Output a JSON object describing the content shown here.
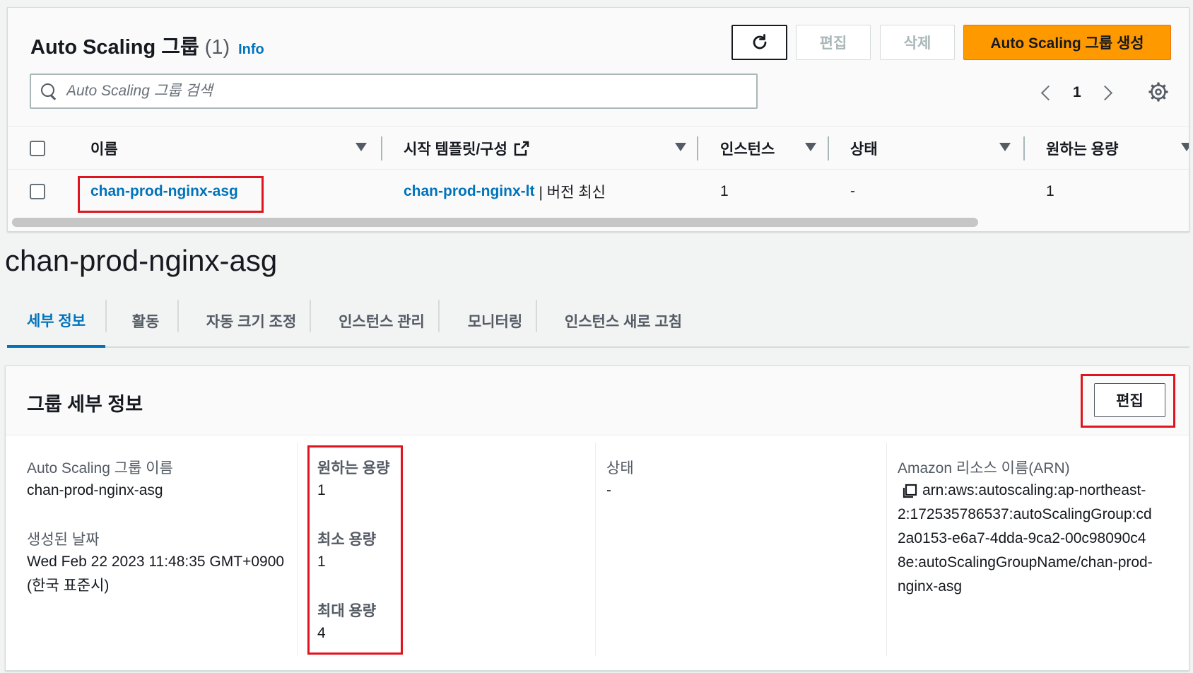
{
  "asg_list": {
    "title": "Auto Scaling 그룹",
    "count": "(1)",
    "info_link": "Info",
    "buttons": {
      "refresh": "refresh",
      "edit": "편집",
      "delete": "삭제",
      "create": "Auto Scaling 그룹 생성"
    },
    "search": {
      "placeholder": "Auto Scaling 그룹 검색",
      "value": ""
    },
    "pagination": {
      "current_page": "1"
    },
    "columns": {
      "name": "이름",
      "launch_template": "시작 템플릿/구성",
      "instances": "인스턴스",
      "status": "상태",
      "desired_capacity": "원하는 용량"
    },
    "rows": [
      {
        "name": "chan-prod-nginx-asg",
        "launch_template": "chan-prod-nginx-lt",
        "launch_template_suffix": "| 버전 최신",
        "instances": "1",
        "status": "-",
        "desired_capacity": "1"
      }
    ]
  },
  "detail": {
    "title": "chan-prod-nginx-asg",
    "tabs": [
      "세부 정보",
      "활동",
      "자동 크기 조정",
      "인스턴스 관리",
      "모니터링",
      "인스턴스 새로 고침"
    ],
    "active_tab": "세부 정보",
    "group_details": {
      "heading": "그룹 세부 정보",
      "edit_button": "편집",
      "asg_name_label": "Auto Scaling 그룹 이름",
      "asg_name_value": "chan-prod-nginx-asg",
      "created_label": "생성된 날짜",
      "created_value_line1": "Wed Feb 22 2023 11:48:35 GMT+0900",
      "created_value_line2": "(한국 표준시)",
      "desired_label": "원하는 용량",
      "desired_value": "1",
      "min_label": "최소 용량",
      "min_value": "1",
      "max_label": "최대 용량",
      "max_value": "4",
      "status_label": "상태",
      "status_value": "-",
      "arn_label": "Amazon 리소스 이름(ARN)",
      "arn_lines": [
        "arn:aws:autoscaling:ap-northeast-",
        "2:172535786537:autoScalingGroup:cd",
        "2a0153-e6a7-4dda-9ca2-00c98090c4",
        "8e:autoScalingGroupName/chan-prod-",
        "nginx-asg"
      ]
    }
  },
  "colors": {
    "primary_button": "#ff9900",
    "link": "#0073bb",
    "highlight_box": "#e0141e"
  }
}
